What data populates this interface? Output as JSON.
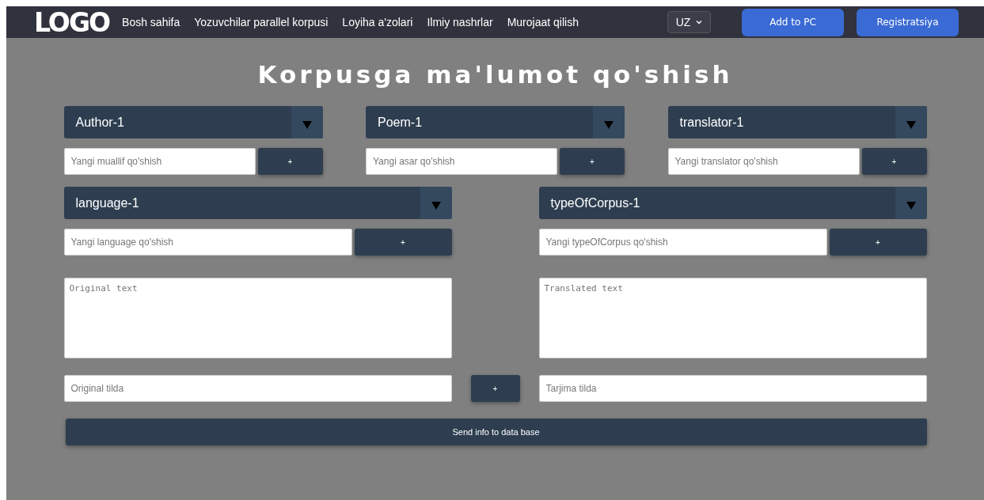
{
  "navbar": {
    "logo": "LOGO",
    "links": [
      "Bosh sahifa",
      "Yozuvchilar parallel korpusi",
      "Loyiha a'zolari",
      "Ilmiy nashrlar",
      "Murojaat qilish"
    ],
    "language": "UZ",
    "buttons": [
      "Add to PC",
      "Registratsiya"
    ]
  },
  "title": "Korpusga ma'lumot qo'shish",
  "row_1": [
    {
      "select": "Author-1",
      "placeholder": "Yangi muallif qo'shish",
      "add": "+"
    },
    {
      "select": "Poem-1",
      "placeholder": "Yangi asar qo'shish",
      "add": "+"
    },
    {
      "select": "translator-1",
      "placeholder": "Yangi translator qo'shish",
      "add": "+"
    }
  ],
  "row_2": [
    {
      "select": "language-1",
      "placeholder": "Yangi language qo'shish",
      "add": "+"
    },
    {
      "select": "typeOfCorpus-1",
      "placeholder": "Yangi typeOfCorpus qo'shish",
      "add": "+"
    }
  ],
  "texts": [
    {
      "placeholder": "Original text"
    },
    {
      "placeholder": "Translated text"
    }
  ],
  "lines": {
    "original": {
      "placeholder": "Original tilda"
    },
    "add": "+",
    "translated": {
      "placeholder": "Tarjima tilda"
    }
  },
  "submit": "Send info to data base"
}
